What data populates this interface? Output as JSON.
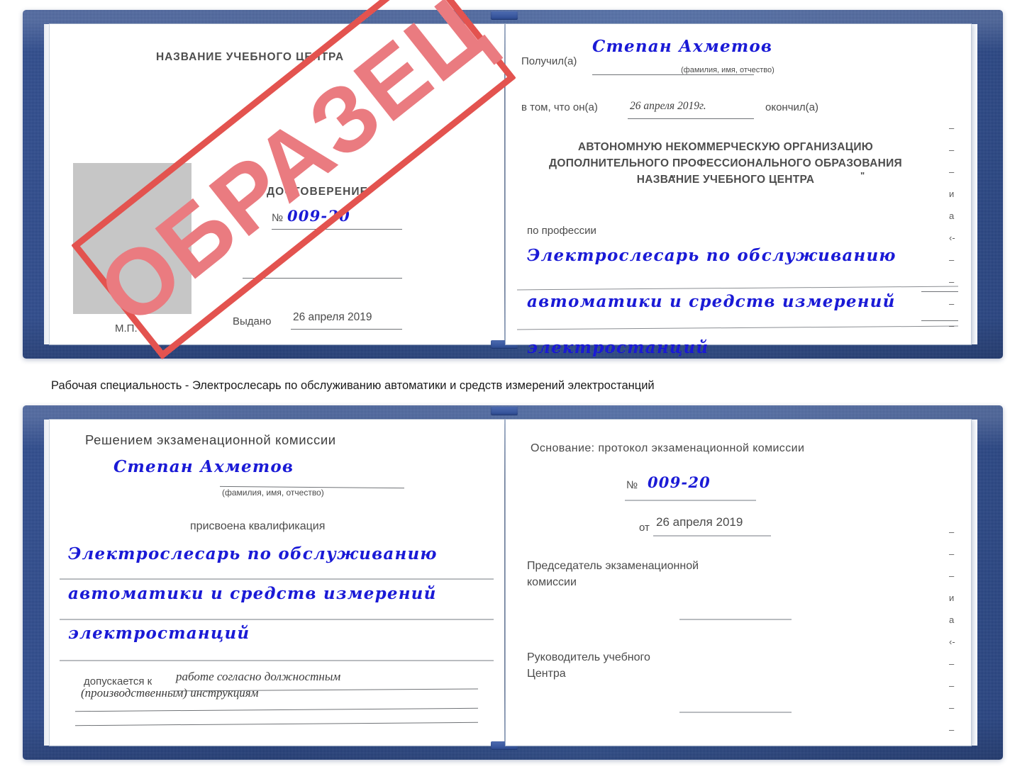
{
  "caption": {
    "text": "Рабочая специальность - Электрослесарь по обслуживанию автоматики и средств измерений электростанций"
  },
  "stamp": {
    "label": "ОБРАЗЕЦ",
    "border_color": "#e3534f",
    "text_color": "#ea7b80"
  },
  "colors": {
    "cover_blue": "#24448c",
    "ink_blue": "#1a1ad6",
    "paper_white": "#ffffff",
    "photo_gray": "#c6c6c6",
    "rule_gray": "#b9bcc0"
  },
  "certificate_top": {
    "left_page": {
      "center_name": "НАЗВАНИЕ УЧЕБНОГО ЦЕНТРА",
      "doc_title": "УДОСТОВЕРЕНИЕ",
      "number_label": "№",
      "number_value": "009-20",
      "issued_label": "Выдано",
      "issued_value": "26 апреля 2019",
      "seal_label": "М.П.",
      "photo_placeholder": ""
    },
    "right_page": {
      "received_label": "Получил(а)",
      "received_value": "Степан Ахметов",
      "fio_hint": "(фамилия, имя, отчество)",
      "in_that_label": "в том, что он(а)",
      "in_that_value": "26 апреля 2019г.",
      "finished_label": "окончил(а)",
      "org_line1": "АВТОНОМНУЮ НЕКОММЕРЧЕСКУЮ ОРГАНИЗАЦИЮ",
      "org_line2": "ДОПОЛНИТЕЛЬНОГО ПРОФЕССИОНАЛЬНОГО ОБРАЗОВАНИЯ",
      "org_quote_open": "\"",
      "org_line3": "НАЗВАНИЕ УЧЕБНОГО ЦЕНТРА",
      "org_quote_close": "\"",
      "profession_label": "по профессии",
      "profession_line1": "Электрослесарь по обслуживанию",
      "profession_line2": "автоматики и средств измерений",
      "profession_line3": "электростанций",
      "edge_marks": [
        "–",
        "–",
        "–",
        "и",
        "а",
        "‹-",
        "–",
        "–",
        "–",
        "–"
      ]
    }
  },
  "certificate_bottom": {
    "left_page": {
      "decision_label": "Решением экзаменационной комиссии",
      "name_value": "Степан Ахметов",
      "fio_hint": "(фамилия, имя, отчество)",
      "qualification_label": "присвоена квалификация",
      "qualification_line1": "Электрослесарь по обслуживанию",
      "qualification_line2": "автоматики и средств измерений",
      "qualification_line3": "электростанций",
      "admitted_label": "допускается к",
      "admitted_line1": "работе согласно должностным",
      "admitted_line2": "(производственным) инструкциям"
    },
    "right_page": {
      "basis_label": "Основание: протокол экзаменационной комиссии",
      "number_label": "№",
      "number_value": "009-20",
      "date_label": "от",
      "date_value": "26 апреля 2019",
      "chair_line1": "Председатель экзаменационной",
      "chair_line2": "комиссии",
      "head_line1": "Руководитель учебного",
      "head_line2": "Центра",
      "edge_marks": [
        "–",
        "–",
        "–",
        "и",
        "а",
        "‹-",
        "–",
        "–",
        "–",
        "–"
      ]
    }
  }
}
